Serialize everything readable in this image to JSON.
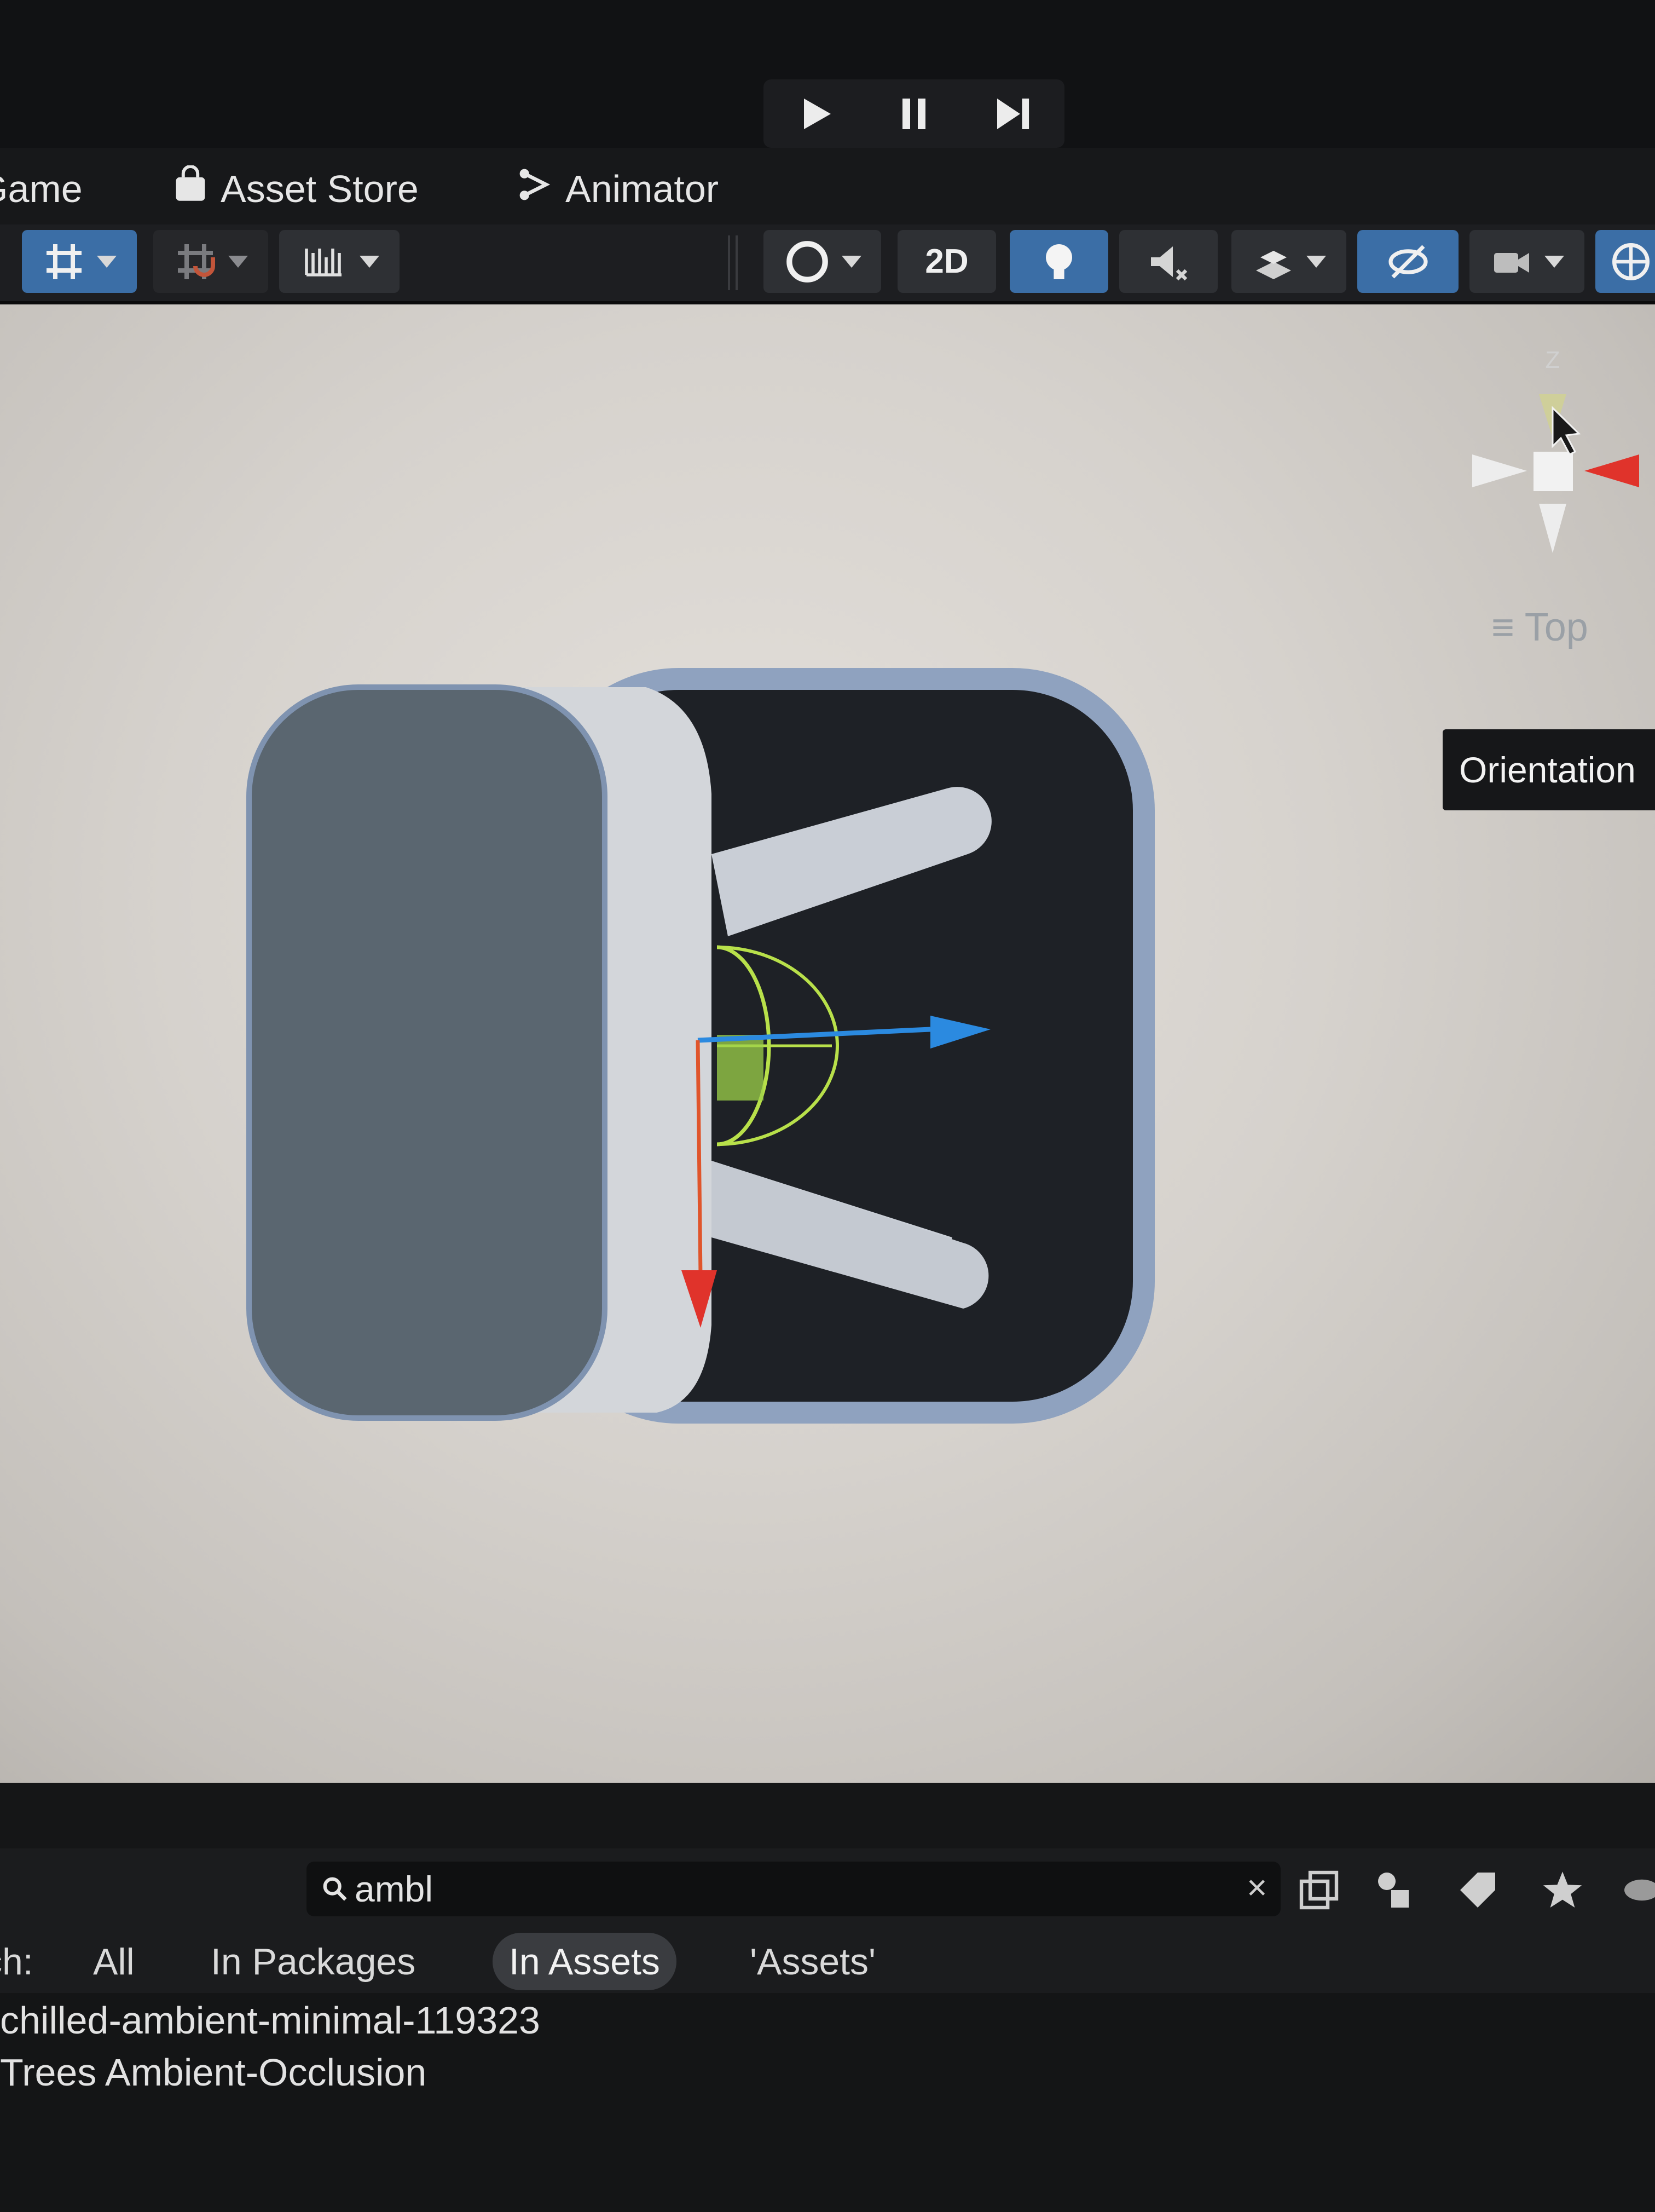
{
  "playbar": {
    "buttons": [
      {
        "name": "play",
        "icon": "play-icon"
      },
      {
        "name": "pause",
        "icon": "pause-icon"
      },
      {
        "name": "step",
        "icon": "step-icon"
      }
    ]
  },
  "tabs": [
    {
      "label": "Game"
    },
    {
      "label": "Asset Store",
      "icon": "shopping-bag-icon"
    },
    {
      "label": "Animator",
      "icon": "animator-icon"
    }
  ],
  "toolbar": {
    "view_2d_label": "2D",
    "items": [
      "snap-icon",
      "grid-snap-icon",
      "increment-snap-icon",
      "shading-mode-icon",
      "2d-toggle",
      "lighting-icon",
      "audio-icon",
      "effects-icon",
      "hidden-visibility-icon",
      "camera-icon",
      "gizmos-icon"
    ]
  },
  "scene": {
    "orientation_label": "Top",
    "axis_label": "Z",
    "tooltip": "Orientation",
    "colors": {
      "x_axis": "#e0332b",
      "y_axis": "#8ce04a",
      "z_axis": "#2b8ae0",
      "body": "#5a6670",
      "frame": "#8fa2bf"
    }
  },
  "project": {
    "search_query": "ambl",
    "filter_prefix": "ch:",
    "filters": [
      "All",
      "In Packages",
      "In Assets",
      "'Assets'"
    ],
    "selected_filter": "In Assets",
    "results": [
      "chilled-ambient-minimal-119323",
      "Trees Ambient-Occlusion"
    ]
  }
}
